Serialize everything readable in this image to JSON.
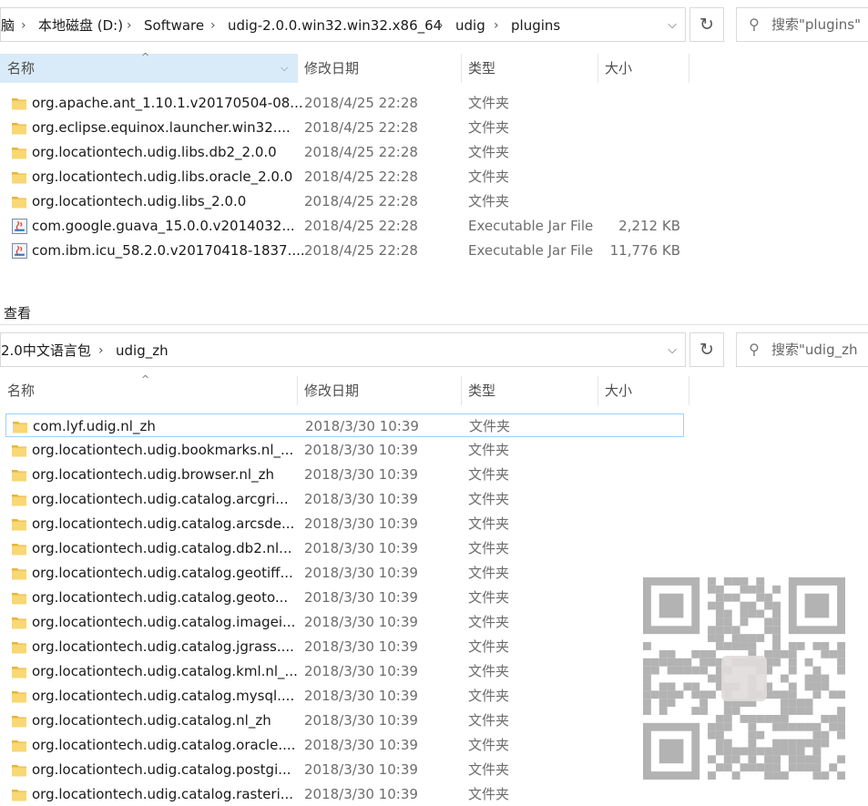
{
  "top": {
    "breadcrumbs": [
      "脑",
      "本地磁盘 (D:)",
      "Software",
      "udig-2.0.0.win32.win32.x86_64",
      "udig",
      "plugins"
    ],
    "search_placeholder": "搜索\"plugins\"",
    "columns": [
      "名称",
      "修改日期",
      "类型",
      "大小"
    ],
    "files": [
      {
        "name": "org.apache.ant_1.10.1.v20170504-08...",
        "date": "2018/4/25 22:28",
        "type": "文件夹",
        "size": "",
        "icon": "folder-icon"
      },
      {
        "name": "org.eclipse.equinox.launcher.win32....",
        "date": "2018/4/25 22:28",
        "type": "文件夹",
        "size": "",
        "icon": "folder-icon"
      },
      {
        "name": "org.locationtech.udig.libs.db2_2.0.0",
        "date": "2018/4/25 22:28",
        "type": "文件夹",
        "size": "",
        "icon": "folder-icon"
      },
      {
        "name": "org.locationtech.udig.libs.oracle_2.0.0",
        "date": "2018/4/25 22:28",
        "type": "文件夹",
        "size": "",
        "icon": "folder-icon"
      },
      {
        "name": "org.locationtech.udig.libs_2.0.0",
        "date": "2018/4/25 22:28",
        "type": "文件夹",
        "size": "",
        "icon": "folder-icon"
      },
      {
        "name": "com.google.guava_15.0.0.v2014032...",
        "date": "2018/4/25 22:28",
        "type": "Executable Jar File",
        "size": "2,212 KB",
        "icon": "jar-icon"
      },
      {
        "name": "com.ibm.icu_58.2.0.v20170418-1837....",
        "date": "2018/4/25 22:28",
        "type": "Executable Jar File",
        "size": "11,776 KB",
        "icon": "jar-icon"
      }
    ]
  },
  "view_label": "查看",
  "bottom": {
    "breadcrumbs": [
      "2.0中文语言包",
      "udig_zh"
    ],
    "search_placeholder": "搜索\"udig_zh",
    "columns": [
      "名称",
      "修改日期",
      "类型",
      "大小"
    ],
    "files": [
      {
        "name": "com.lyf.udig.nl_zh",
        "date": "2018/3/30 10:39",
        "type": "文件夹",
        "size": ""
      },
      {
        "name": "org.locationtech.udig.bookmarks.nl_...",
        "date": "2018/3/30 10:39",
        "type": "文件夹",
        "size": ""
      },
      {
        "name": "org.locationtech.udig.browser.nl_zh",
        "date": "2018/3/30 10:39",
        "type": "文件夹",
        "size": ""
      },
      {
        "name": "org.locationtech.udig.catalog.arcgri...",
        "date": "2018/3/30 10:39",
        "type": "文件夹",
        "size": ""
      },
      {
        "name": "org.locationtech.udig.catalog.arcsde...",
        "date": "2018/3/30 10:39",
        "type": "文件夹",
        "size": ""
      },
      {
        "name": "org.locationtech.udig.catalog.db2.nl...",
        "date": "2018/3/30 10:39",
        "type": "文件夹",
        "size": ""
      },
      {
        "name": "org.locationtech.udig.catalog.geotiff...",
        "date": "2018/3/30 10:39",
        "type": "文件夹",
        "size": ""
      },
      {
        "name": "org.locationtech.udig.catalog.geoto...",
        "date": "2018/3/30 10:39",
        "type": "文件夹",
        "size": ""
      },
      {
        "name": "org.locationtech.udig.catalog.imagei...",
        "date": "2018/3/30 10:39",
        "type": "文件夹",
        "size": ""
      },
      {
        "name": "org.locationtech.udig.catalog.jgrass....",
        "date": "2018/3/30 10:39",
        "type": "文件夹",
        "size": ""
      },
      {
        "name": "org.locationtech.udig.catalog.kml.nl_...",
        "date": "2018/3/30 10:39",
        "type": "文件夹",
        "size": ""
      },
      {
        "name": "org.locationtech.udig.catalog.mysql....",
        "date": "2018/3/30 10:39",
        "type": "文件夹",
        "size": ""
      },
      {
        "name": "org.locationtech.udig.catalog.nl_zh",
        "date": "2018/3/30 10:39",
        "type": "文件夹",
        "size": ""
      },
      {
        "name": "org.locationtech.udig.catalog.oracle....",
        "date": "2018/3/30 10:39",
        "type": "文件夹",
        "size": ""
      },
      {
        "name": "org.locationtech.udig.catalog.postgi...",
        "date": "2018/3/30 10:39",
        "type": "文件夹",
        "size": ""
      },
      {
        "name": "org.locationtech.udig.catalog.rasteri...",
        "date": "2018/3/30 10:39",
        "type": "文件夹",
        "size": ""
      }
    ]
  },
  "colors": {
    "header_selected": "#d9ebf9",
    "selection_border": "#99d1ff",
    "folder": "#f8d775"
  },
  "qr_icon": "qr-code-watermark"
}
